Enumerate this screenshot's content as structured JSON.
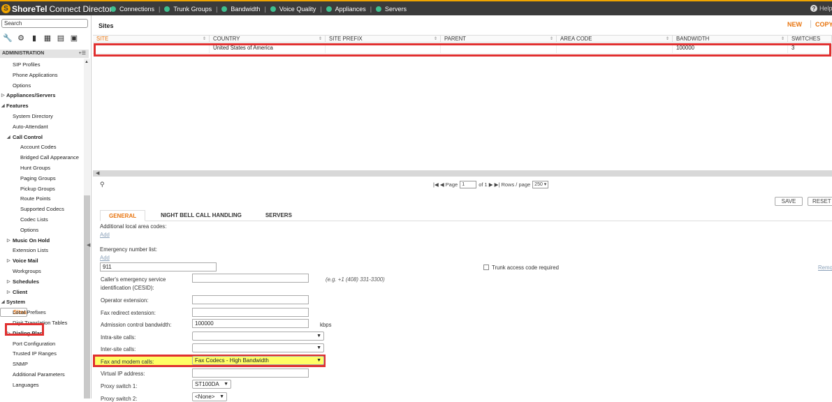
{
  "app": {
    "brand": "ShoreTel",
    "product": "Connect Director",
    "help": "Help"
  },
  "topnav": [
    "Connections",
    "Trunk Groups",
    "Bandwidth",
    "Voice Quality",
    "Appliances",
    "Servers"
  ],
  "sidebar": {
    "search_value": "Search",
    "section": "ADMINISTRATION",
    "tree": [
      {
        "label": "SIP Profiles"
      },
      {
        "label": "Phone Applications"
      },
      {
        "label": "Options"
      },
      {
        "label": "Appliances/Servers"
      },
      {
        "label": "Features"
      },
      {
        "label": "System Directory"
      },
      {
        "label": "Auto-Attendant"
      },
      {
        "label": "Call Control"
      },
      {
        "label": "Account Codes"
      },
      {
        "label": "Bridged Call Appearance"
      },
      {
        "label": "Hunt Groups"
      },
      {
        "label": "Paging Groups"
      },
      {
        "label": "Pickup Groups"
      },
      {
        "label": "Route Points"
      },
      {
        "label": "Supported Codecs"
      },
      {
        "label": "Codec Lists"
      },
      {
        "label": "Options"
      },
      {
        "label": "Music On Hold"
      },
      {
        "label": "Extension Lists"
      },
      {
        "label": "Voice Mail"
      },
      {
        "label": "Workgroups"
      },
      {
        "label": "Schedules"
      },
      {
        "label": "Client"
      },
      {
        "label": "System"
      },
      {
        "label": "Sites"
      },
      {
        "label": "Local Prefixes"
      },
      {
        "label": "Digit Translation Tables"
      },
      {
        "label": "Dialing Plan"
      },
      {
        "label": "Port Configuration"
      },
      {
        "label": "Trusted IP Ranges"
      },
      {
        "label": "SNMP"
      },
      {
        "label": "Additional Parameters"
      },
      {
        "label": "Languages"
      }
    ]
  },
  "main": {
    "title": "Sites",
    "new_label": "NEW",
    "copy_label": "COPY",
    "columns": [
      "SITE",
      "COUNTRY",
      "SITE PREFIX",
      "PARENT",
      "AREA CODE",
      "BANDWIDTH",
      "SWITCHES"
    ],
    "row": {
      "site": "",
      "country": "United States of America",
      "site_prefix": "",
      "parent": "",
      "area_code": "",
      "bandwidth": "100000",
      "switches": "3"
    },
    "pager": {
      "page_label": "Page",
      "page_value": "1",
      "of_label": "of 1",
      "rows_label": "Rows / page",
      "rows_value": "250"
    },
    "save_label": "SAVE",
    "reset_label": "RESET",
    "tabs": [
      "GENERAL",
      "NIGHT BELL CALL HANDLING",
      "SERVERS"
    ],
    "form": {
      "additional_codes_label": "Additional local area codes:",
      "add1": "Add",
      "emergency_label": "Emergency number list:",
      "add2": "Add",
      "emergency_value": "911",
      "trunk_label": "Trunk access code required",
      "remove_label": "Remo",
      "cesid_label1": "Caller's emergency service",
      "cesid_label2": "identification (CESID):",
      "cesid_hint": "(e.g. +1 (408) 331-3300)",
      "operator_label": "Operator extension:",
      "fax_redirect_label": "Fax redirect extension:",
      "admission_label": "Admission control bandwidth:",
      "admission_value": "100000",
      "admission_unit": "kbps",
      "intra_label": "Intra-site calls:",
      "inter_label": "Inter-site calls:",
      "fax_label": "Fax and modem calls:",
      "fax_value": "Fax Codecs - High Bandwidth",
      "vip_label": "Virtual IP address:",
      "proxy1_label": "Proxy switch 1:",
      "proxy1_value": "ST100DA",
      "proxy2_label": "Proxy switch 2:",
      "proxy2_value": "<None>"
    }
  },
  "colors": {
    "accent": "#e8730c",
    "highlight": "#e03030",
    "topbar": "#3b3b3b",
    "nav_dot": "#3fbf8f"
  }
}
